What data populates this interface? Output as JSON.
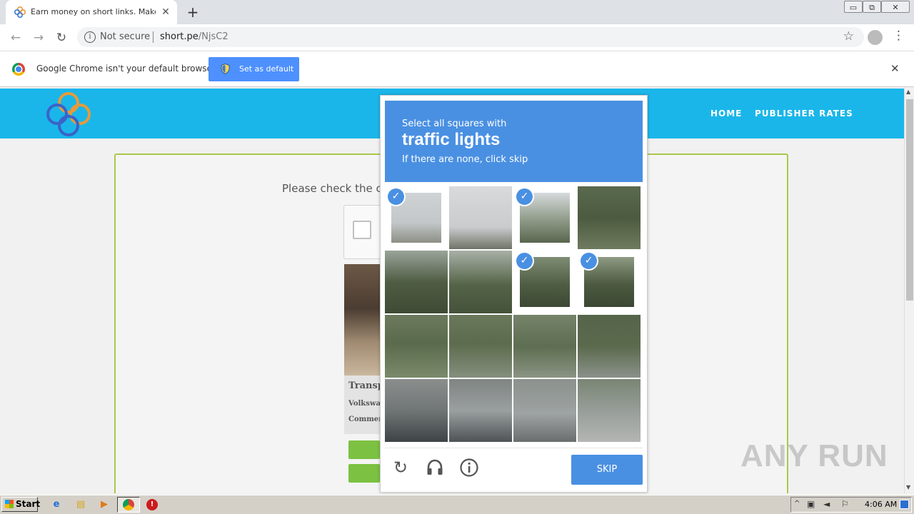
{
  "browser": {
    "tab_title": "Earn money on short links. Make sho",
    "tab_close": "✕",
    "new_tab": "+",
    "window_controls": [
      "▭",
      "⧉",
      "✕"
    ],
    "security_label": "Not secure",
    "url_host": "short.pe",
    "url_path": "/NjsC2"
  },
  "infobar": {
    "message": "Google Chrome isn't your default browser",
    "button": "Set as default",
    "close": "✕"
  },
  "site": {
    "nav": [
      "HOME",
      "PUBLISHER RATES"
    ],
    "please_check": "Please check the c",
    "ad": {
      "title": "Transp",
      "line1": "Volkswag",
      "line2": "Commer"
    }
  },
  "challenge": {
    "line1": "Select all squares with",
    "target": "traffic lights",
    "line2": "If there are none, click skip",
    "selected_cells": [
      0,
      2,
      6,
      7
    ],
    "skip": "SKIP",
    "icons": [
      "reload-icon",
      "audio-icon",
      "info-icon"
    ]
  },
  "watermark": "ANY RUN",
  "taskbar": {
    "start": "Start",
    "clock": "4:06 AM"
  },
  "colors": {
    "site_header": "#1ab6ea",
    "captcha_blue": "#4a90e2",
    "infobar_button": "#4d90fe",
    "content_border": "#a9c94b",
    "green_button": "#7cc142"
  }
}
